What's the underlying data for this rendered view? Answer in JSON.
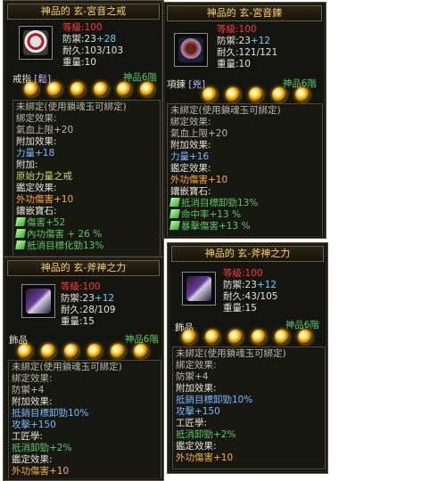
{
  "panel1": {
    "title": "神品的 玄-宮音之戒",
    "icon": "ring-icon",
    "stats": {
      "level_label": "等級",
      "level": ":100",
      "def_label": "防禦",
      "def": ":23",
      "def_bonus": "+28",
      "dur_label": "耐久",
      "dur": ":103/103",
      "weight_label": "重量",
      "weight": ":10"
    },
    "slot_label": "戒指",
    "slot_type": "[鬆]",
    "rank": "神品6階",
    "lines": [
      {
        "t": "未綁定(使用鎖魂玉可綁定)",
        "c": "gy"
      },
      {
        "t": "綁定效果:",
        "c": "gy"
      },
      {
        "t": "氣血上限+20",
        "c": "gy"
      },
      {
        "t": "附加效果:",
        "c": "w"
      },
      {
        "t": "力量+18",
        "c": "bl"
      },
      {
        "t": "附加:",
        "c": "w"
      },
      {
        "t": "原始力量之戒",
        "c": "yg"
      },
      {
        "t": "鑑定效果:",
        "c": "w"
      },
      {
        "t": "外功傷害+10",
        "c": "or"
      },
      {
        "t": "鑲嵌寶石:",
        "c": "w"
      }
    ],
    "gems": [
      "傷害+52",
      "內功傷害 + 26 %",
      "抵消目標化勁13%"
    ]
  },
  "panel2": {
    "title": "神品的 玄-宮音鍊",
    "icon": "necklace-icon",
    "stats": {
      "level_label": "等級",
      "level": ":100",
      "def_label": "防禦",
      "def": ":23",
      "def_bonus": "+12",
      "dur_label": "耐久",
      "dur": ":121/121",
      "weight_label": "重量",
      "weight": ":10"
    },
    "slot_label": "項鍊",
    "slot_type": "[兇]",
    "rank": "神品6階",
    "lines": [
      {
        "t": "未綁定(使用鎖魂玉可綁定)",
        "c": "gy"
      },
      {
        "t": "綁定效果:",
        "c": "gy"
      },
      {
        "t": "氣血上限+20",
        "c": "gy"
      },
      {
        "t": "附加效果:",
        "c": "w"
      },
      {
        "t": "力量+16",
        "c": "bl"
      },
      {
        "t": "鑑定效果:",
        "c": "w"
      },
      {
        "t": "外功傷害+10",
        "c": "or"
      },
      {
        "t": "鑲嵌寶石:",
        "c": "w"
      }
    ],
    "gems": [
      "抵消目標卸勁13%",
      "命中率+13 %",
      "暴擊傷害+13 %"
    ]
  },
  "panel3": {
    "title": "神品的 玄-斧神之力",
    "icon": "armor-icon",
    "stats": {
      "level_label": "等級",
      "level": ":100",
      "def_label": "防禦",
      "def": ":23",
      "def_bonus": "+12",
      "dur_label": "耐久",
      "dur": ":28/109",
      "weight_label": "重量",
      "weight": ":15"
    },
    "slot_label": "飾品",
    "rank": "神品6階",
    "lines": [
      {
        "t": "未綁定(使用鎖魂玉可綁定)",
        "c": "gy"
      },
      {
        "t": "綁定效果:",
        "c": "gy"
      },
      {
        "t": "防禦+4",
        "c": "gy"
      },
      {
        "t": "附加效果:",
        "c": "w"
      },
      {
        "t": "抵銷目標卸勁10%",
        "c": "bl"
      },
      {
        "t": "攻擊+150",
        "c": "bl"
      },
      {
        "t": "工匠學:",
        "c": "w"
      },
      {
        "t": "抵消卸勁+2%",
        "c": "gr"
      },
      {
        "t": "鑑定效果:",
        "c": "w"
      },
      {
        "t": "外功傷害+10",
        "c": "or"
      }
    ]
  },
  "panel4": {
    "title": "神品的 玄-斧神之力",
    "icon": "armor-icon",
    "stats": {
      "level_label": "等級",
      "level": ":100",
      "def_label": "防禦",
      "def": ":23",
      "def_bonus": "+12",
      "dur_label": "耐久",
      "dur": ":43/105",
      "weight_label": "重量",
      "weight": ":15"
    },
    "slot_label": "飾品",
    "rank": "神品6階",
    "lines": [
      {
        "t": "未綁定(使用鎖魂玉可綁定)",
        "c": "gy"
      },
      {
        "t": "綁定效果:",
        "c": "gy"
      },
      {
        "t": "防禦+4",
        "c": "gy"
      },
      {
        "t": "附加效果:",
        "c": "w"
      },
      {
        "t": "抵銷目標卸勁10%",
        "c": "bl"
      },
      {
        "t": "攻擊+150",
        "c": "bl"
      },
      {
        "t": "工匠學:",
        "c": "w"
      },
      {
        "t": "抵消卸勁+2%",
        "c": "gr"
      },
      {
        "t": "鑑定效果:",
        "c": "w"
      },
      {
        "t": "外功傷害+10",
        "c": "or"
      }
    ]
  }
}
